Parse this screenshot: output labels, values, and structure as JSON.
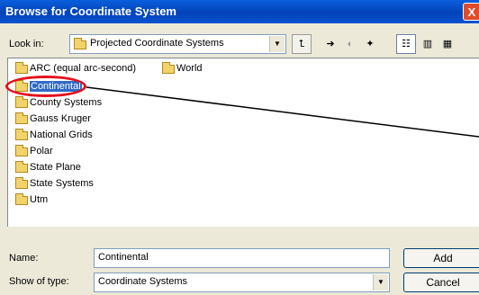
{
  "window": {
    "title": "Browse for Coordinate System",
    "close_glyph": "X"
  },
  "lookin": {
    "label": "Look in:",
    "value": "Projected Coordinate Systems",
    "icon": "folder-icon"
  },
  "toolbar": [
    {
      "name": "up-one-level-icon",
      "glyph": "⮤"
    },
    {
      "name": "connect-folder-icon",
      "glyph": "➜"
    },
    {
      "name": "disconnect-folder-icon",
      "glyph": "◐"
    },
    {
      "name": "new-folder-icon",
      "glyph": "✦"
    },
    {
      "name": "list-view-icon",
      "glyph": "☷"
    },
    {
      "name": "details-view-icon",
      "glyph": "▥"
    },
    {
      "name": "thumbnails-view-icon",
      "glyph": "▦"
    }
  ],
  "folders": [
    "ARC (equal arc-second)",
    "World",
    "Continental",
    "County Systems",
    "Gauss Kruger",
    "National Grids",
    "Polar",
    "State Plane",
    "State Systems",
    "Utm"
  ],
  "selected_folder": "Continental",
  "name_field": {
    "label": "Name:",
    "value": "Continental"
  },
  "type_field": {
    "label": "Show of type:",
    "value": "Coordinate Systems"
  },
  "buttons": {
    "add": "Add",
    "cancel": "Cancel"
  },
  "annotation_color": "#e3101c"
}
